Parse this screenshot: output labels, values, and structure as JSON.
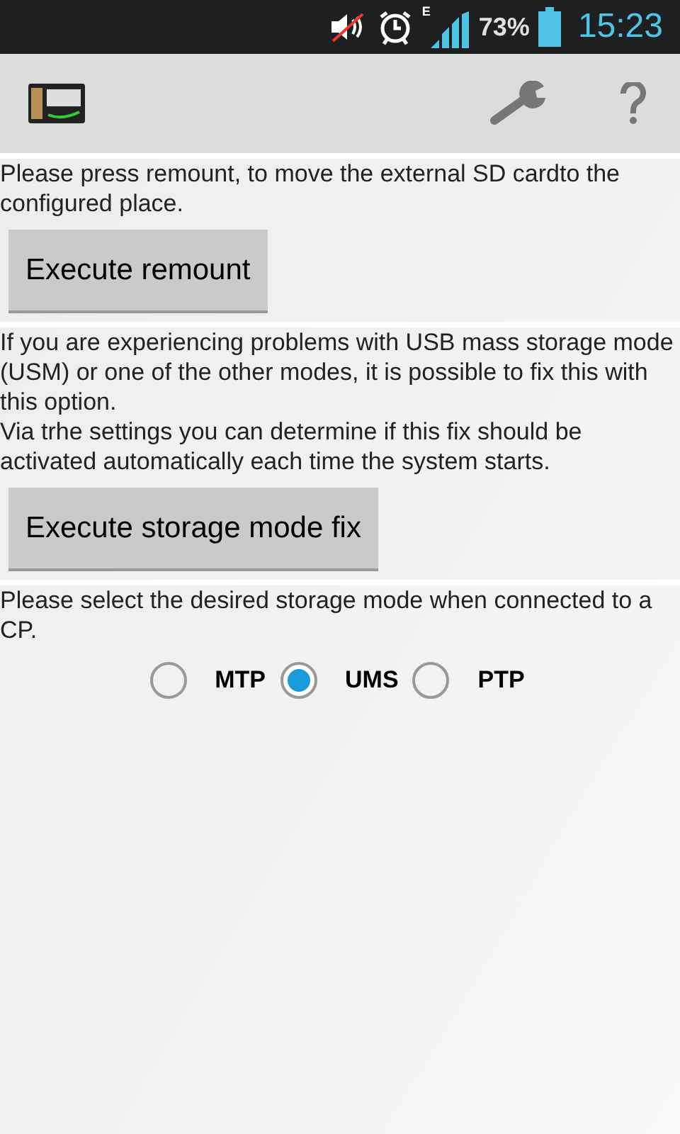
{
  "status_bar": {
    "network": "E",
    "battery": "73%",
    "time": "15:23"
  },
  "sections": [
    {
      "text": "Please press remount, to move the external SD cardto the configured place.",
      "button": "Execute remount"
    },
    {
      "text": "If you are experiencing problems with USB mass storage mode (USM) or one of the other modes, it is possible to fix this with this option.\nVia trhe settings you can determine if this fix should be activated automatically each time the system starts.",
      "button": "Execute storage mode fix"
    }
  ],
  "mode_prompt": "Please select the desired storage mode when connected to a CP.",
  "modes": [
    {
      "label": "MTP",
      "selected": false
    },
    {
      "label": "UMS",
      "selected": true
    },
    {
      "label": "PTP",
      "selected": false
    }
  ]
}
